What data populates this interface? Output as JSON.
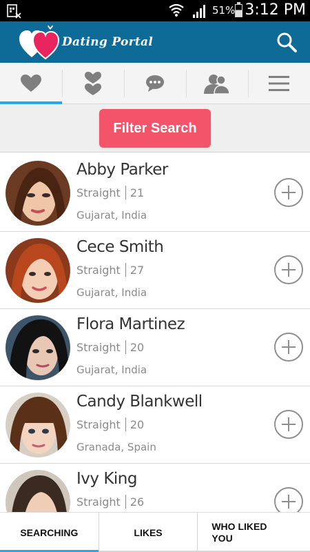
{
  "status_bar": {
    "battery_percent": "51%",
    "time": "3:12 PM",
    "icons": [
      "sim-card-icon",
      "wifi-icon",
      "signal-icon",
      "battery-icon"
    ]
  },
  "app_bar": {
    "title": "Dating Portal",
    "logo_icon": "hearts-logo-icon",
    "search_icon": "search-icon"
  },
  "tabs": [
    {
      "icon": "heart-icon",
      "active": true
    },
    {
      "icon": "couple-hearts-icon",
      "active": false
    },
    {
      "icon": "chat-bubble-icon",
      "active": false
    },
    {
      "icon": "users-icon",
      "active": false
    },
    {
      "icon": "menu-icon",
      "active": false
    }
  ],
  "filter": {
    "label": "Filter Search"
  },
  "profiles": [
    {
      "name": "Abby Parker",
      "orientation": "Straight",
      "age": "21",
      "location": "Gujarat, India"
    },
    {
      "name": "Cece Smith",
      "orientation": "Straight",
      "age": "27",
      "location": "Gujarat, India"
    },
    {
      "name": "Flora Martinez",
      "orientation": "Straight",
      "age": "20",
      "location": "Gujarat, India"
    },
    {
      "name": "Candy Blankwell",
      "orientation": "Straight",
      "age": "20",
      "location": "Granada, Spain"
    },
    {
      "name": "Ivy King",
      "orientation": "Straight",
      "age": "26",
      "location": ""
    }
  ],
  "bottom_tabs": [
    {
      "label": "SEARCHING",
      "active": true
    },
    {
      "label": "LIKES",
      "active": false
    },
    {
      "label": "WHO LIKED YOU",
      "active": false
    }
  ],
  "colors": {
    "app_bar": "#0e6a97",
    "accent": "#29a7e8",
    "filter_button": "#f4546a",
    "logo_heart": "#e8255e"
  }
}
